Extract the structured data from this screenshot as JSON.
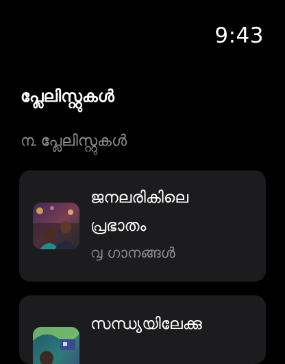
{
  "status_bar": {
    "time": "9:43"
  },
  "header": {
    "title": "പ്ലേലിസ്റ്റുകൾ"
  },
  "section": {
    "label": "൩ പ്ലേലിസ്റ്റുകൾ"
  },
  "playlists": [
    {
      "title_line1": "ജനലരികിലെ",
      "title_line2": "പ്രഭാതം",
      "subtitle": "൮ ഗാനങ്ങൾ"
    },
    {
      "title_line1": "സന്ധ്യയിലേക്കു"
    }
  ],
  "colors": {
    "background": "#000000",
    "card": "#1c1c1e",
    "primary_text": "#ffffff",
    "secondary_text": "#8e8e93"
  }
}
